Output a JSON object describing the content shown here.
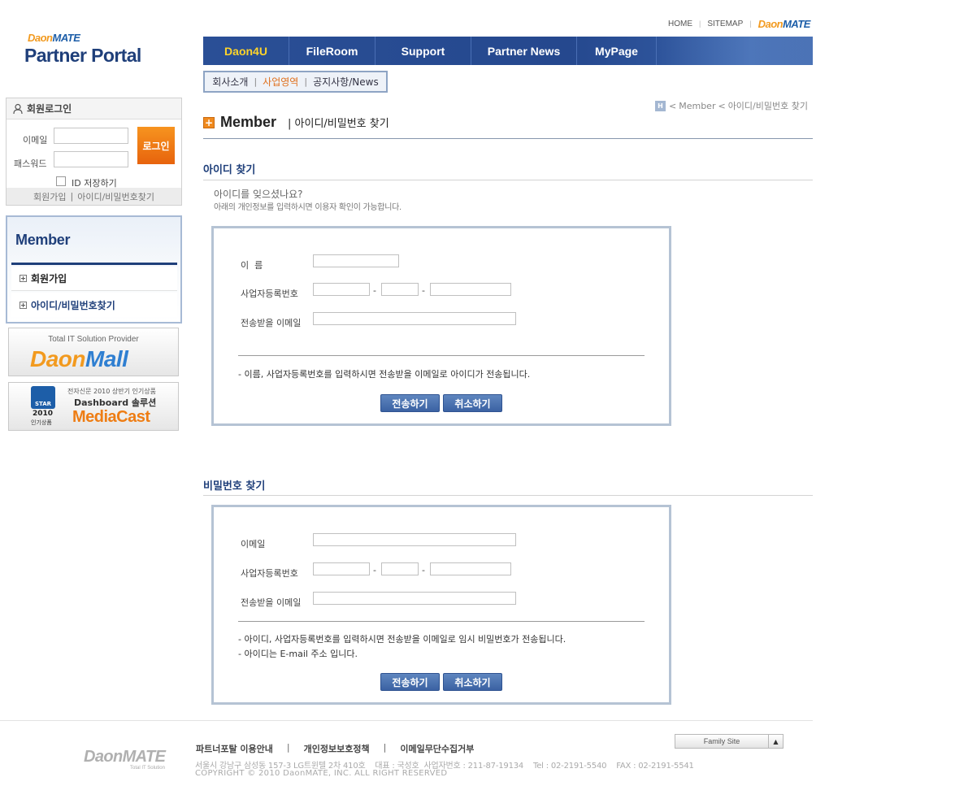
{
  "toplinks": {
    "home": "HOME",
    "sitemap": "SITEMAP",
    "brand_a": "Daon",
    "brand_b": "MATE"
  },
  "logo": {
    "brand_a": "Daon",
    "brand_b": "MATE",
    "title": "Partner Portal"
  },
  "gnb": [
    {
      "label": "Daon4U",
      "active": true
    },
    {
      "label": "FileRoom"
    },
    {
      "label": "Support"
    },
    {
      "label": "Partner News"
    },
    {
      "label": "MyPage"
    }
  ],
  "submenu": {
    "item1": "회사소개",
    "item2": "사업영역",
    "item3": "공지사항/News"
  },
  "login": {
    "title": "회원로그인",
    "email_label": "이메일",
    "password_label": "패스워드",
    "button": "로그인",
    "save_id": "ID 저장하기",
    "join": "회원가입",
    "find": "아이디/비밀번호찾기"
  },
  "sidemenu": {
    "title": "Member",
    "items": [
      "회원가입",
      "아이디/비밀번호찾기"
    ]
  },
  "banners": {
    "mall_sub": "Total IT Solution Provider",
    "mall_a": "Daon",
    "mall_b": "Mall",
    "media_top": "전자신문 2010 상반기 인기상품",
    "media_mid": "Dashboard 솔루션",
    "media_big": "MediaCast",
    "media_badge": "STAR",
    "media_year": "2010",
    "media_year_sub": "인기상품"
  },
  "breadcrumb": {
    "home": "H",
    "level1": "Member",
    "level2": "아이디/비밀번호 찾기"
  },
  "page": {
    "title": "Member",
    "subtitle": "| 아이디/비밀번호 찾기"
  },
  "find_id": {
    "title": "아이디 찾기",
    "question": "아이디를 잊으셨나요?",
    "desc": "아래의 개인정보를 입력하시면 이용자 확인이 가능합니다.",
    "name_label": "이  름",
    "biz_label": "사업자등록번호",
    "email_label": "전송받을 이메일",
    "dash": "-",
    "note": "- 이름, 사업자등록번호를 입력하시면 전송받을 이메일로 아이디가 전송됩니다.",
    "submit": "전송하기",
    "cancel": "취소하기"
  },
  "find_pw": {
    "title": "비밀번호 찾기",
    "email_label": "이메일",
    "biz_label": "사업자등록번호",
    "recv_label": "전송받을 이메일",
    "dash": "-",
    "note1": "- 아이디, 사업자등록번호를 입력하시면 전송받을 이메일로 임시 비밀번호가 전송됩니다.",
    "note2": "- 아이디는 E-mail 주소 입니다.",
    "submit": "전송하기",
    "cancel": "취소하기"
  },
  "footer": {
    "logo": "DaonMATE",
    "logo_sub": "Total IT Solution",
    "link1": "파트너포탈 이용안내",
    "link2": "개인정보보호정책",
    "link3": "이메일무단수집거부",
    "sep": "|",
    "address": "서울시 강남구 삼성동 157-3 LG트윈텔 2차 410호    대표 : 국성호  사업자번호 : 211-87-19134    Tel : 02-2191-5540    FAX : 02-2191-5541",
    "copyright": "COPYRIGHT © 2010 DaonMATE, INC. ALL RIGHT RESERVED",
    "family_site": "Family Site"
  }
}
